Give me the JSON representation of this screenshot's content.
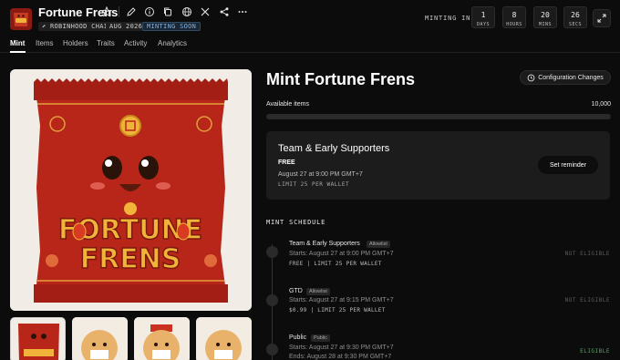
{
  "header": {
    "title": "Fortune Frens",
    "tags": {
      "chain": "ROBINHOOD CHAIN",
      "date": "AUG 2026",
      "status": "MINTING SOON"
    },
    "minting_in_label": "MINTING IN",
    "countdown": [
      {
        "value": "1",
        "label": "DAYS"
      },
      {
        "value": "8",
        "label": "HOURS"
      },
      {
        "value": "20",
        "label": "MINS"
      },
      {
        "value": "26",
        "label": "SECS"
      }
    ]
  },
  "tabs": [
    "Mint",
    "Items",
    "Holders",
    "Traits",
    "Activity",
    "Analytics"
  ],
  "artwork": {
    "line1": "FORTUNE",
    "line2": "FRENS"
  },
  "mint": {
    "title": "Mint Fortune Frens",
    "config_button": "Configuration Changes",
    "available_label": "Available items",
    "available_value": "10,000",
    "progress_fraction": 0
  },
  "current_phase": {
    "title": "Team & Early Supporters",
    "price": "FREE",
    "date": "August 27 at 9:00 PM GMT+7",
    "limit": "LIMIT 25 PER WALLET",
    "reminder_button": "Set reminder"
  },
  "schedule": {
    "title": "MINT SCHEDULE",
    "phases": [
      {
        "name": "Team & Early Supporters",
        "badge": "Allowlist",
        "line1": "Starts: August 27 at 9:00 PM GMT+7",
        "line2": "FREE | LIMIT 25 PER WALLET",
        "status": "NOT ELIGIBLE"
      },
      {
        "name": "GTD",
        "badge": "Allowlist",
        "line1": "Starts: August 27 at 9:15 PM GMT+7",
        "line2": "$0.99 | LIMIT 25 PER WALLET",
        "status": "NOT ELIGIBLE"
      },
      {
        "name": "Public",
        "badge": "Public",
        "line1": "Starts: August 27 at 9:30 PM GMT+7",
        "line2": "Ends: August 28 at 9:30 PM GMT+7",
        "status": "ELIGIBLE"
      }
    ]
  },
  "colors": {
    "accent_red": "#b8261a",
    "gold": "#f2b33a",
    "eligible": "#4fa865",
    "bg": "#0c0c0c"
  },
  "icons": [
    "star-icon",
    "pencil-icon",
    "info-icon",
    "copy-icon",
    "globe-icon",
    "x-logo-icon",
    "share-icon",
    "more-icon",
    "expand-icon",
    "history-icon"
  ]
}
